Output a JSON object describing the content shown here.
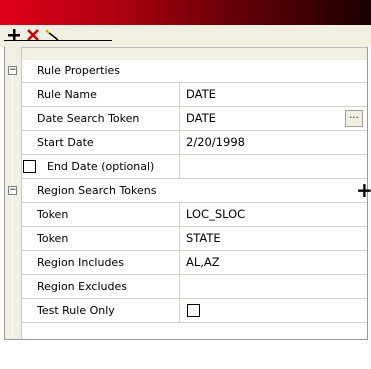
{
  "toolbar": {
    "add_icon": "plus-icon",
    "delete_icon": "delete-x-icon",
    "wand_icon": "magic-wand-icon"
  },
  "categories": {
    "rule_properties": "Rule Properties",
    "region_search_tokens": "Region Search Tokens"
  },
  "rows": {
    "rule_name": {
      "label": "Rule Name",
      "value": "DATE"
    },
    "date_search_token": {
      "label": "Date Search Token",
      "value": "DATE",
      "button": "..."
    },
    "start_date": {
      "label": "Start Date",
      "value": "2/20/1998"
    },
    "end_date": {
      "label": "End Date (optional)",
      "checked": false
    },
    "token1": {
      "label": "Token",
      "value": "LOC_SLOC"
    },
    "token2": {
      "label": "Token",
      "value": "STATE"
    },
    "region_includes": {
      "label": "Region Includes",
      "value": "AL,AZ"
    },
    "region_excludes": {
      "label": "Region Excludes",
      "value": ""
    },
    "test_rule_only": {
      "label": "Test Rule Only",
      "checked": false
    }
  },
  "colors": {
    "titlebar_start": "#e0001a",
    "titlebar_end": "#1a0001",
    "toolbar_bg": "#f1efe2",
    "delete_red": "#cc0000"
  }
}
